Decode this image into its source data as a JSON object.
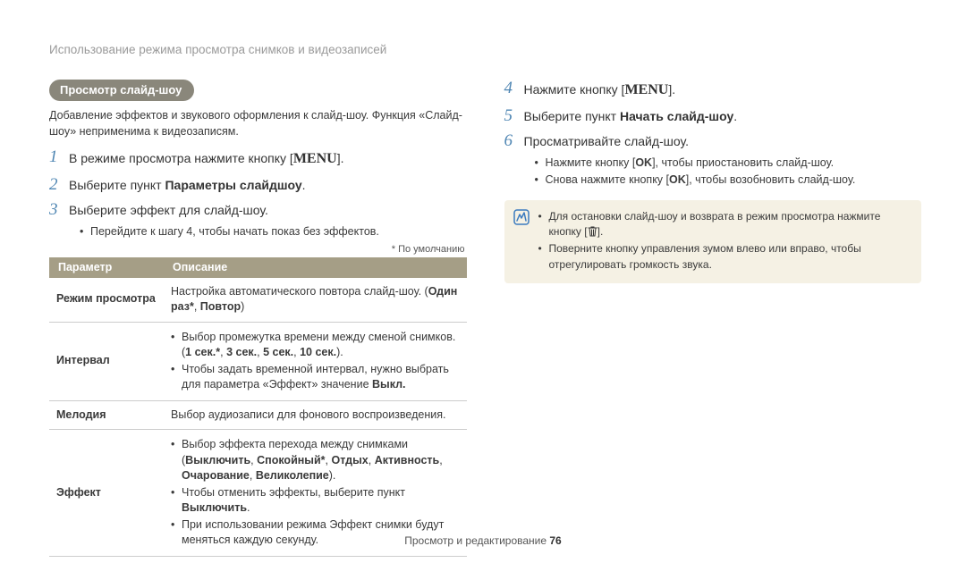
{
  "breadcrumb": "Использование режима просмотра снимков и видеозаписей",
  "pill": "Просмотр слайд-шоу",
  "intro": "Добавление эффектов и звукового оформления к слайд-шоу. Функция «Слайд-шоу» неприменима к видеозаписям.",
  "step1_a": "В режиме просмотра нажмите кнопку [",
  "step1_b": "].",
  "menu_label": "MENU",
  "step2_a": "Выберите пункт ",
  "step2_bold": "Параметры слайдшоу",
  "step2_b": ".",
  "step3": "Выберите эффект для слайд-шоу.",
  "step3_sub": "Перейдите к шагу 4, чтобы начать показ без эффектов.",
  "default_note": "* По умолчанию",
  "thead_param": "Параметр",
  "thead_desc": "Описание",
  "row1_param": "Режим просмотра",
  "row1_desc_a": "Настройка автоматического повтора слайд-шоу. (",
  "row1_desc_bold": "Один раз*",
  "row1_desc_b": ", ",
  "row1_desc_bold2": "Повтор",
  "row1_desc_c": ")",
  "row2_param": "Интервал",
  "row2_li1_a": "Выбор промежутка времени между сменой снимков. (",
  "row2_li1_bold": "1 сек.*",
  "row2_li1_b": ", ",
  "row2_li1_bold2": "3 сек.",
  "row2_li1_c": ", ",
  "row2_li1_bold3": "5 сек.",
  "row2_li1_d": ", ",
  "row2_li1_bold4": "10 сек.",
  "row2_li1_e": ").",
  "row2_li2_a": "Чтобы задать временной интервал, нужно выбрать для параметра «Эффект» значение ",
  "row2_li2_bold": "Выкл.",
  "row3_param": "Мелодия",
  "row3_desc": "Выбор аудиозаписи для фонового воспроизведения.",
  "row4_param": "Эффект",
  "row4_li1_a": "Выбор эффекта перехода между снимками (",
  "row4_li1_bold1": "Выключить",
  "row4_li1_s1": ", ",
  "row4_li1_bold2": "Спокойный*",
  "row4_li1_s2": ", ",
  "row4_li1_bold3": "Отдых",
  "row4_li1_s3": ", ",
  "row4_li1_bold4": "Активность",
  "row4_li1_s4": ", ",
  "row4_li1_bold5": "Очарование",
  "row4_li1_s5": ", ",
  "row4_li1_bold6": "Великолепие",
  "row4_li1_e": ").",
  "row4_li2_a": "Чтобы отменить эффекты, выберите пункт ",
  "row4_li2_bold": "Выключить",
  "row4_li2_b": ".",
  "row4_li3": "При использовании режима Эффект снимки будут меняться каждую секунду.",
  "step4_a": "Нажмите кнопку [",
  "step4_b": "].",
  "step5_a": "Выберите пункт ",
  "step5_bold": "Начать слайд-шоу",
  "step5_b": ".",
  "step6": "Просматривайте слайд-шоу.",
  "step6_sub1_a": "Нажмите кнопку [",
  "ok_label": "OK",
  "step6_sub1_b": "], чтобы приостановить слайд-шоу.",
  "step6_sub2_a": "Снова нажмите кнопку [",
  "step6_sub2_b": "], чтобы возобновить слайд-шоу.",
  "note_li1_a": "Для остановки слайд-шоу и возврата в режим просмотра нажмите кнопку [",
  "note_li1_b": "].",
  "note_li2": "Поверните кнопку управления зумом влево или вправо, чтобы отрегулировать громкость звука.",
  "footer_a": "Просмотр и редактирование  ",
  "footer_page": "76"
}
